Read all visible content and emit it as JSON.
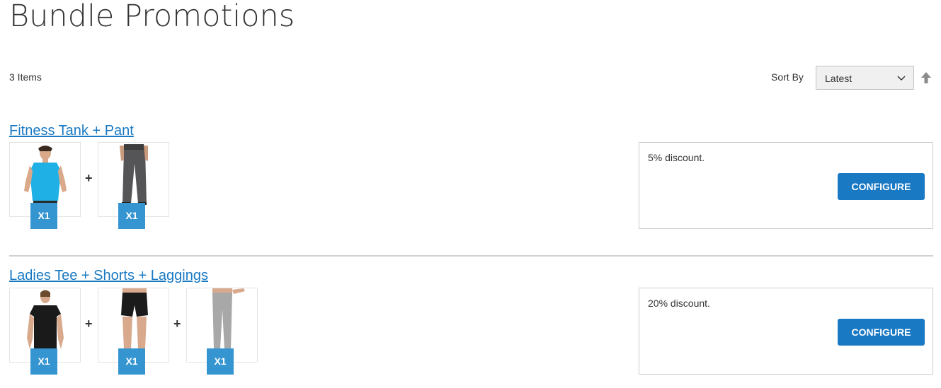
{
  "page": {
    "title": "Bundle Promotions"
  },
  "toolbar": {
    "amount": "3 Items",
    "sort_label": "Sort By",
    "sort_value": "Latest"
  },
  "bundles": [
    {
      "title": "Fitness Tank + Pant",
      "items": [
        {
          "qty": "X1",
          "product": "blue-tank-top"
        },
        {
          "qty": "X1",
          "product": "grey-pants"
        }
      ],
      "separator": "+",
      "description": "5% discount.",
      "button": "CONFIGURE"
    },
    {
      "title": "Ladies Tee + Shorts + Laggings",
      "items": [
        {
          "qty": "X1",
          "product": "black-tee"
        },
        {
          "qty": "X1",
          "product": "black-shorts"
        },
        {
          "qty": "X1",
          "product": "grey-leggings"
        }
      ],
      "separator": "+",
      "description": "20% discount.",
      "button": "CONFIGURE"
    }
  ],
  "colors": {
    "link": "#1979c3",
    "qty_badge": "#3595d1",
    "button": "#1979c3"
  }
}
